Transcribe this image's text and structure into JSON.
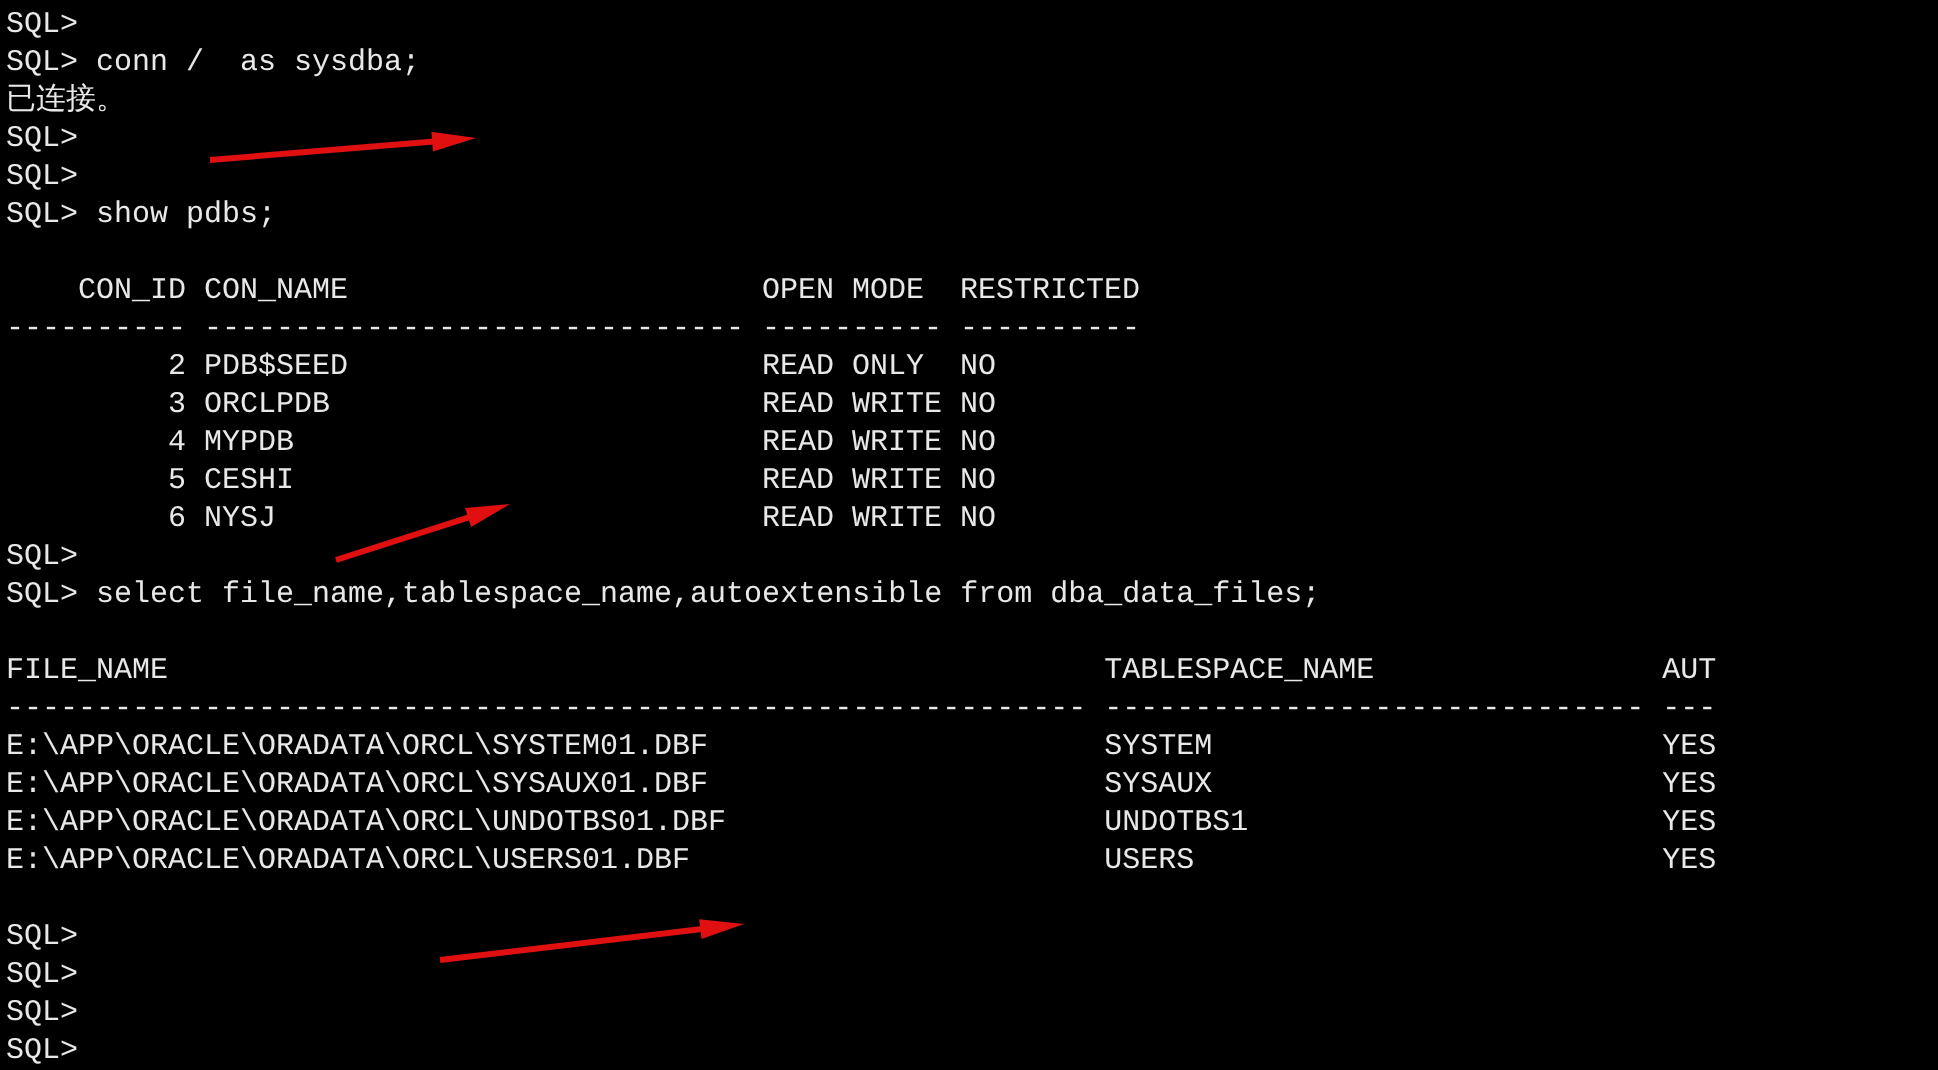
{
  "terminal": {
    "sections": [
      {
        "kind": "lines",
        "lines": [
          "SQL>",
          "SQL> conn /  as sysdba;",
          "已连接。",
          "SQL>",
          "SQL>",
          "SQL> show pdbs;"
        ]
      },
      {
        "kind": "blank"
      },
      {
        "kind": "table",
        "columns": [
          {
            "header": "CON_ID",
            "rule": "----------",
            "right_aligned": true
          },
          {
            "header": "CON_NAME",
            "rule": "------------------------------",
            "right_aligned": false
          },
          {
            "header": "OPEN MODE",
            "rule": "----------",
            "right_aligned": false
          },
          {
            "header": "RESTRICTED",
            "rule": "----------",
            "right_aligned": false
          }
        ],
        "rows": [
          [
            "2",
            "PDB$SEED",
            "READ ONLY",
            "NO"
          ],
          [
            "3",
            "ORCLPDB",
            "READ WRITE",
            "NO"
          ],
          [
            "4",
            "MYPDB",
            "READ WRITE",
            "NO"
          ],
          [
            "5",
            "CESHI",
            "READ WRITE",
            "NO"
          ],
          [
            "6",
            "NYSJ",
            "READ WRITE",
            "NO"
          ]
        ]
      },
      {
        "kind": "lines",
        "lines": [
          "SQL>",
          "SQL> select file_name,tablespace_name,autoextensible from dba_data_files;"
        ]
      },
      {
        "kind": "blank"
      },
      {
        "kind": "table",
        "columns": [
          {
            "header": "FILE_NAME",
            "rule": "------------------------------------------------------------",
            "right_aligned": false
          },
          {
            "header": "TABLESPACE_NAME",
            "rule": "------------------------------",
            "right_aligned": false
          },
          {
            "header": "AUT",
            "rule": "---"
          }
        ],
        "rows": [
          [
            "E:\\APP\\ORACLE\\ORADATA\\ORCL\\SYSTEM01.DBF",
            "SYSTEM",
            "YES"
          ],
          [
            "E:\\APP\\ORACLE\\ORADATA\\ORCL\\SYSAUX01.DBF",
            "SYSAUX",
            "YES"
          ],
          [
            "E:\\APP\\ORACLE\\ORADATA\\ORCL\\UNDOTBS01.DBF",
            "UNDOTBS1",
            "YES"
          ],
          [
            "E:\\APP\\ORACLE\\ORADATA\\ORCL\\USERS01.DBF",
            "USERS",
            "YES"
          ]
        ]
      },
      {
        "kind": "blank"
      },
      {
        "kind": "lines",
        "lines": [
          "SQL>",
          "SQL>",
          "SQL>",
          "SQL>"
        ]
      }
    ]
  },
  "annotations": [
    {
      "kind": "arrow"
    },
    {
      "kind": "arrow"
    },
    {
      "kind": "arrow"
    }
  ]
}
